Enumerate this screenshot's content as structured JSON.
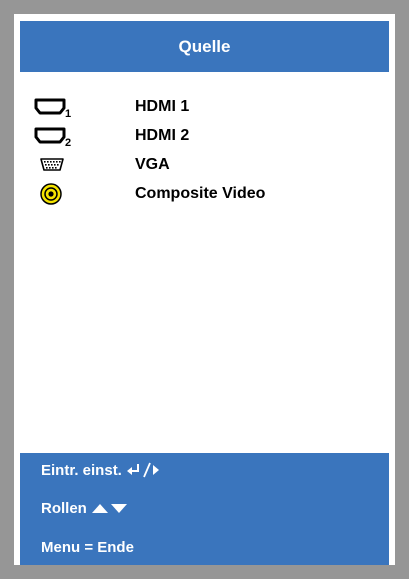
{
  "title": "Quelle",
  "sources": [
    {
      "label": "HDMI 1",
      "icon": "hdmi-1-icon"
    },
    {
      "label": "HDMI 2",
      "icon": "hdmi-2-icon"
    },
    {
      "label": "VGA",
      "icon": "vga-icon"
    },
    {
      "label": "Composite Video",
      "icon": "composite-video-icon"
    }
  ],
  "help": {
    "enter_label": "Eintr. einst.",
    "scroll_label": "Rollen",
    "menu_label": "Menu = Ende"
  },
  "colors": {
    "accent": "#3a75bd",
    "frame": "#969696",
    "composite_yellow": "#f5e400"
  }
}
